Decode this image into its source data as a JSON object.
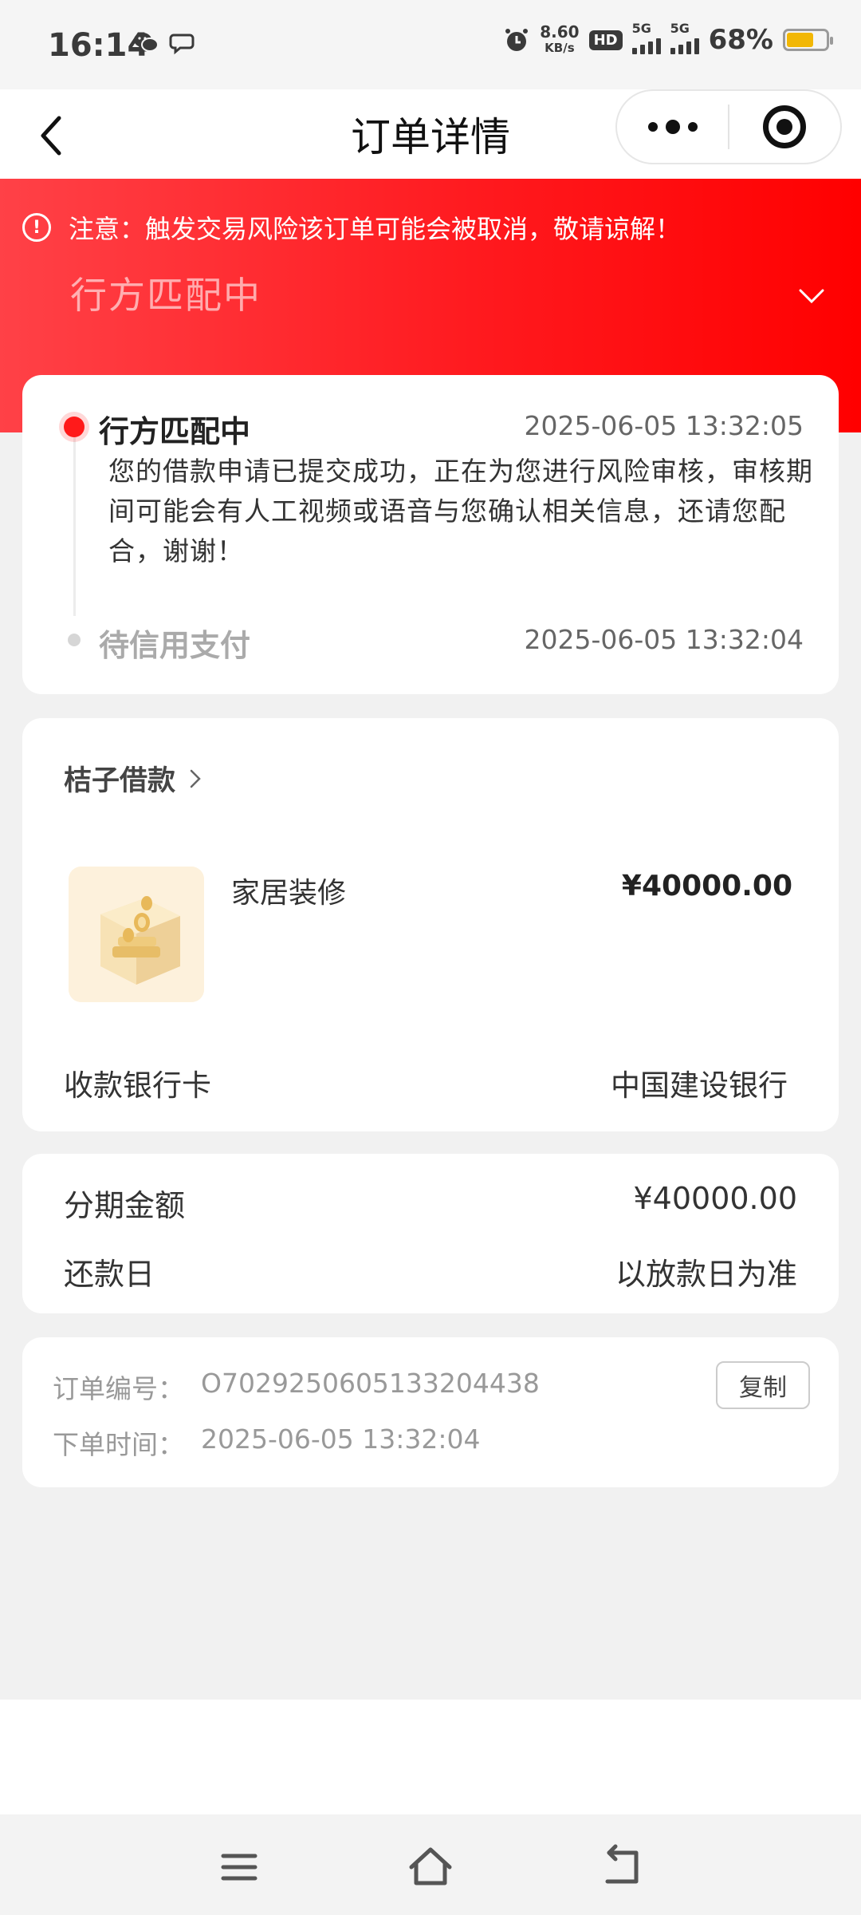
{
  "status_bar": {
    "time": "16:14",
    "net_speed_value": "8.60",
    "net_speed_unit": "KB/s",
    "hd_label": "HD",
    "signal1_label": "5G",
    "signal2_label": "5G",
    "battery_percent": "68%",
    "battery_level": 0.68,
    "battery_color": "#f2b705"
  },
  "nav": {
    "title": "订单详情",
    "back_icon": "chevron-left-icon",
    "more_icon": "more-dots-icon",
    "close_icon": "target-icon"
  },
  "banner": {
    "notice_icon_text": "!",
    "notice": "注意：触发交易风险该订单可能会被取消，敬请谅解！",
    "status": "行方匹配中",
    "accent_color": "#ff1a1f"
  },
  "timeline": [
    {
      "title": "行方匹配中",
      "time": "2025-06-05 13:32:05",
      "description": "您的借款申请已提交成功，正在为您进行风险审核，审核期间可能会有人工视频或语音与您确认相关信息，还请您配合，谢谢！",
      "active": true
    },
    {
      "title": "待信用支付",
      "time": "2025-06-05 13:32:04",
      "active": false
    }
  ],
  "product": {
    "merchant": "桔子借款",
    "name": "家居装修",
    "price": "¥40000.00",
    "bank_label": "收款银行卡",
    "bank_value": "中国建设银行"
  },
  "installment": {
    "amount_label": "分期金额",
    "amount_value": "¥40000.00",
    "repay_label": "还款日",
    "repay_value": "以放款日为准"
  },
  "order": {
    "number_label": "订单编号：",
    "number_value": "O702925060513320443​8",
    "time_label": "下单时间：",
    "time_value": "2025-06-05 13:32:04",
    "copy_label": "复制"
  }
}
